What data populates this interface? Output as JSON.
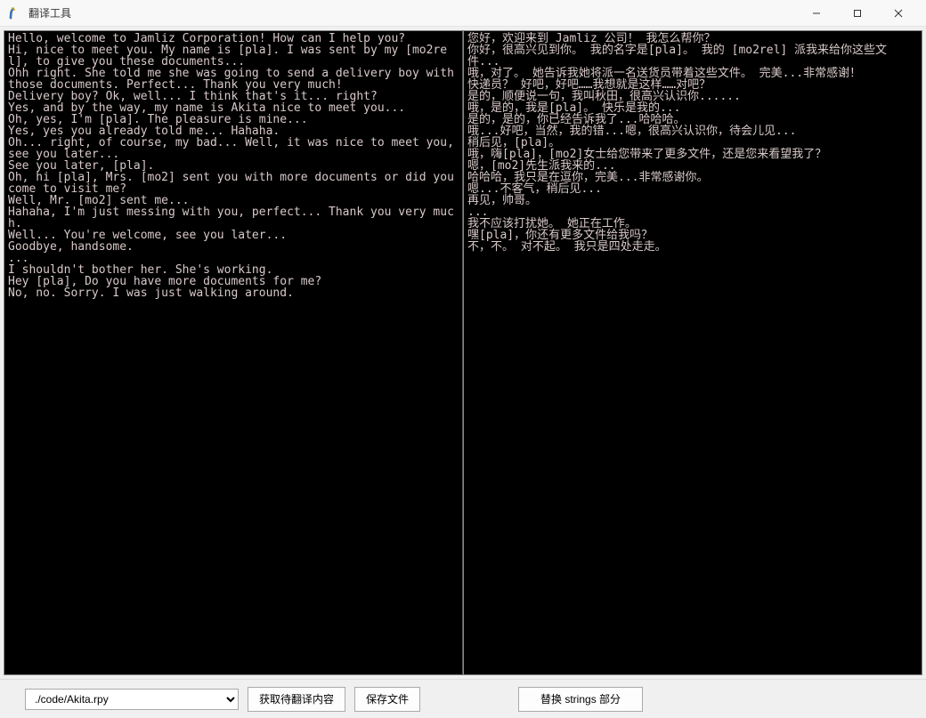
{
  "window": {
    "title": "翻译工具"
  },
  "panels": {
    "left": "Hello, welcome to Jamliz Corporation! How can I help you?\nHi, nice to meet you. My name is [pla]. I was sent by my [mo2rel], to give you these documents...\nOhh right. She told me she was going to send a delivery boy with those documents. Perfect... Thank you very much!\nDelivery boy? Ok, well... I think that's it... right?\nYes, and by the way, my name is Akita nice to meet you...\nOh, yes, I'm [pla]. The pleasure is mine...\nYes, yes you already told me... Hahaha.\nOh... right, of course, my bad... Well, it was nice to meet you, see you later...\nSee you later, [pla].\nOh, hi [pla], Mrs. [mo2] sent you with more documents or did you come to visit me?\nWell, Mr. [mo2] sent me...\nHahaha, I'm just messing with you, perfect... Thank you very much.\nWell... You're welcome, see you later...\nGoodbye, handsome.\n...\nI shouldn't bother her. She's working.\nHey [pla], Do you have more documents for me?\nNo, no. Sorry. I was just walking around.",
    "right": "您好，欢迎来到 Jamliz 公司！ 我怎么帮你？\n你好，很高兴见到你。 我的名字是[pla]。 我的 [mo2rel] 派我来给你这些文件...\n哦，对了。 她告诉我她将派一名送货员带着这些文件。 完美...非常感谢！\n快递员？ 好吧，好吧……我想就是这样……对吧？\n是的，顺便说一句，我叫秋田，很高兴认识你......\n哦，是的，我是[pla]。 快乐是我的...\n是的，是的，你已经告诉我了...哈哈哈。\n哦...好吧，当然，我的错...嗯，很高兴认识你，待会儿见...\n稍后见，[pla]。\n哦，嗨[pla]，[mo2]女士给您带来了更多文件，还是您来看望我了？\n嗯，[mo2]先生派我来的...\n哈哈哈，我只是在逗你，完美...非常感谢你。\n嗯...不客气，稍后见...\n再见，帅哥。\n...\n我不应该打扰她。 她正在工作。\n嘿[pla]，你还有更多文件给我吗？\n不，不。 对不起。 我只是四处走走。"
  },
  "bottom": {
    "file_path": "./code/Akita.rpy",
    "get_content_btn": "获取待翻译内容",
    "save_btn": "保存文件",
    "replace_btn": "替换 strings 部分"
  }
}
